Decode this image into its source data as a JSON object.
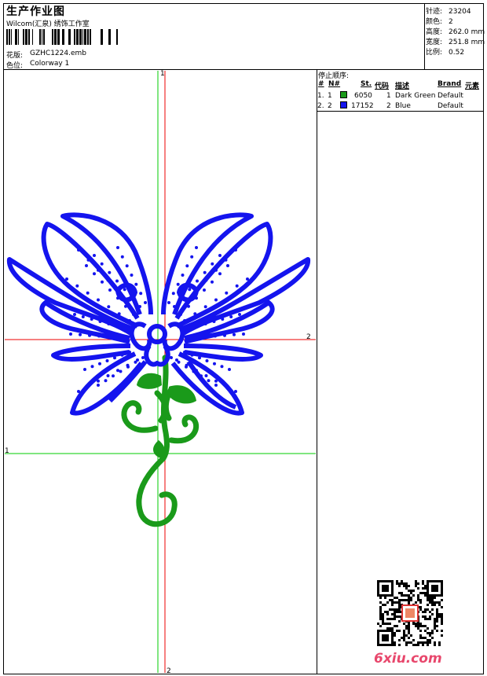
{
  "header": {
    "title": "生产作业图",
    "company": "Wilcom(汇泉) 绣饰工作室",
    "design_label": "花版:",
    "design_value": "GZHC1224.emb",
    "colorway_label": "色位:",
    "colorway_value": "Colorway 1"
  },
  "stats": [
    {
      "label": "针迹:",
      "value": "23204"
    },
    {
      "label": "颜色:",
      "value": "2"
    },
    {
      "label": "高度:",
      "value": "262.0 mm"
    },
    {
      "label": "宽度:",
      "value": "251.8 mm"
    },
    {
      "label": "比例:",
      "value": "0.52"
    }
  ],
  "stop_sequence": {
    "title": "停止顺序:",
    "headers": [
      "#",
      "N#",
      "St.",
      "代码",
      "描述",
      "Brand",
      "元素"
    ],
    "rows": [
      {
        "num": "1.",
        "n": "1",
        "color": "#1a9a1a",
        "stitches": "6050",
        "code": "1",
        "desc": "Dark Green",
        "brand": "Default"
      },
      {
        "num": "2.",
        "n": "2",
        "color": "#1414ee",
        "stitches": "17152",
        "code": "2",
        "desc": "Blue",
        "brand": "Default"
      }
    ]
  },
  "guides": {
    "v_green_label": "1",
    "v_red_label": "2",
    "h_green_label": "1",
    "h_red_label": "2"
  },
  "colors": {
    "green": "#1a9a1a",
    "blue": "#1414ee",
    "guide_green": "#00cc00",
    "guide_red": "#ee0000"
  },
  "watermark": "6xiu.com"
}
